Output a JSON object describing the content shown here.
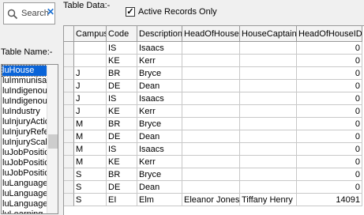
{
  "search": {
    "placeholder": "Search",
    "clear_icon": "x-icon"
  },
  "table_name_label": "Table Name:-",
  "table_list": {
    "items": [
      "luHouse",
      "luImmunisation",
      "luIndigenous",
      "luIndigenous",
      "luIndustry",
      "luInjuryAction",
      "luInjuryReferral",
      "luInjuryScale",
      "luJobPosition",
      "luJobPosition",
      "luJobPosition",
      "luLanguage",
      "luLanguage",
      "luLanguage",
      "luLearning"
    ],
    "selected_index": 0
  },
  "table_data_label": "Table Data:-",
  "active_records": {
    "label": "Active Records Only",
    "checked": true
  },
  "grid": {
    "columns": [
      "Campus",
      "Code",
      "Description",
      "HeadOfHouse",
      "HouseCaptain",
      "HeadOfHouseID"
    ],
    "rows": [
      [
        "",
        "IS",
        "Isaacs",
        "",
        "",
        "0"
      ],
      [
        "",
        "KE",
        "Kerr",
        "",
        "",
        "0"
      ],
      [
        "J",
        "BR",
        "Bryce",
        "",
        "",
        "0"
      ],
      [
        "J",
        "DE",
        "Dean",
        "",
        "",
        "0"
      ],
      [
        "J",
        "IS",
        "Isaacs",
        "",
        "",
        "0"
      ],
      [
        "J",
        "KE",
        "Kerr",
        "",
        "",
        "0"
      ],
      [
        "M",
        "BR",
        "Bryce",
        "",
        "",
        "0"
      ],
      [
        "M",
        "DE",
        "Dean",
        "",
        "",
        "0"
      ],
      [
        "M",
        "IS",
        "Isaacs",
        "",
        "",
        "0"
      ],
      [
        "M",
        "KE",
        "Kerr",
        "",
        "",
        "0"
      ],
      [
        "S",
        "BR",
        "Bryce",
        "",
        "",
        "0"
      ],
      [
        "S",
        "DE",
        "Dean",
        "",
        "",
        "0"
      ],
      [
        "S",
        "EI",
        "Elm",
        "Eleanor Jones",
        "Tiffany Henry",
        "14091"
      ]
    ]
  },
  "colors": {
    "selection": "#0a64d8",
    "header_bg": "#f3f3f3"
  }
}
